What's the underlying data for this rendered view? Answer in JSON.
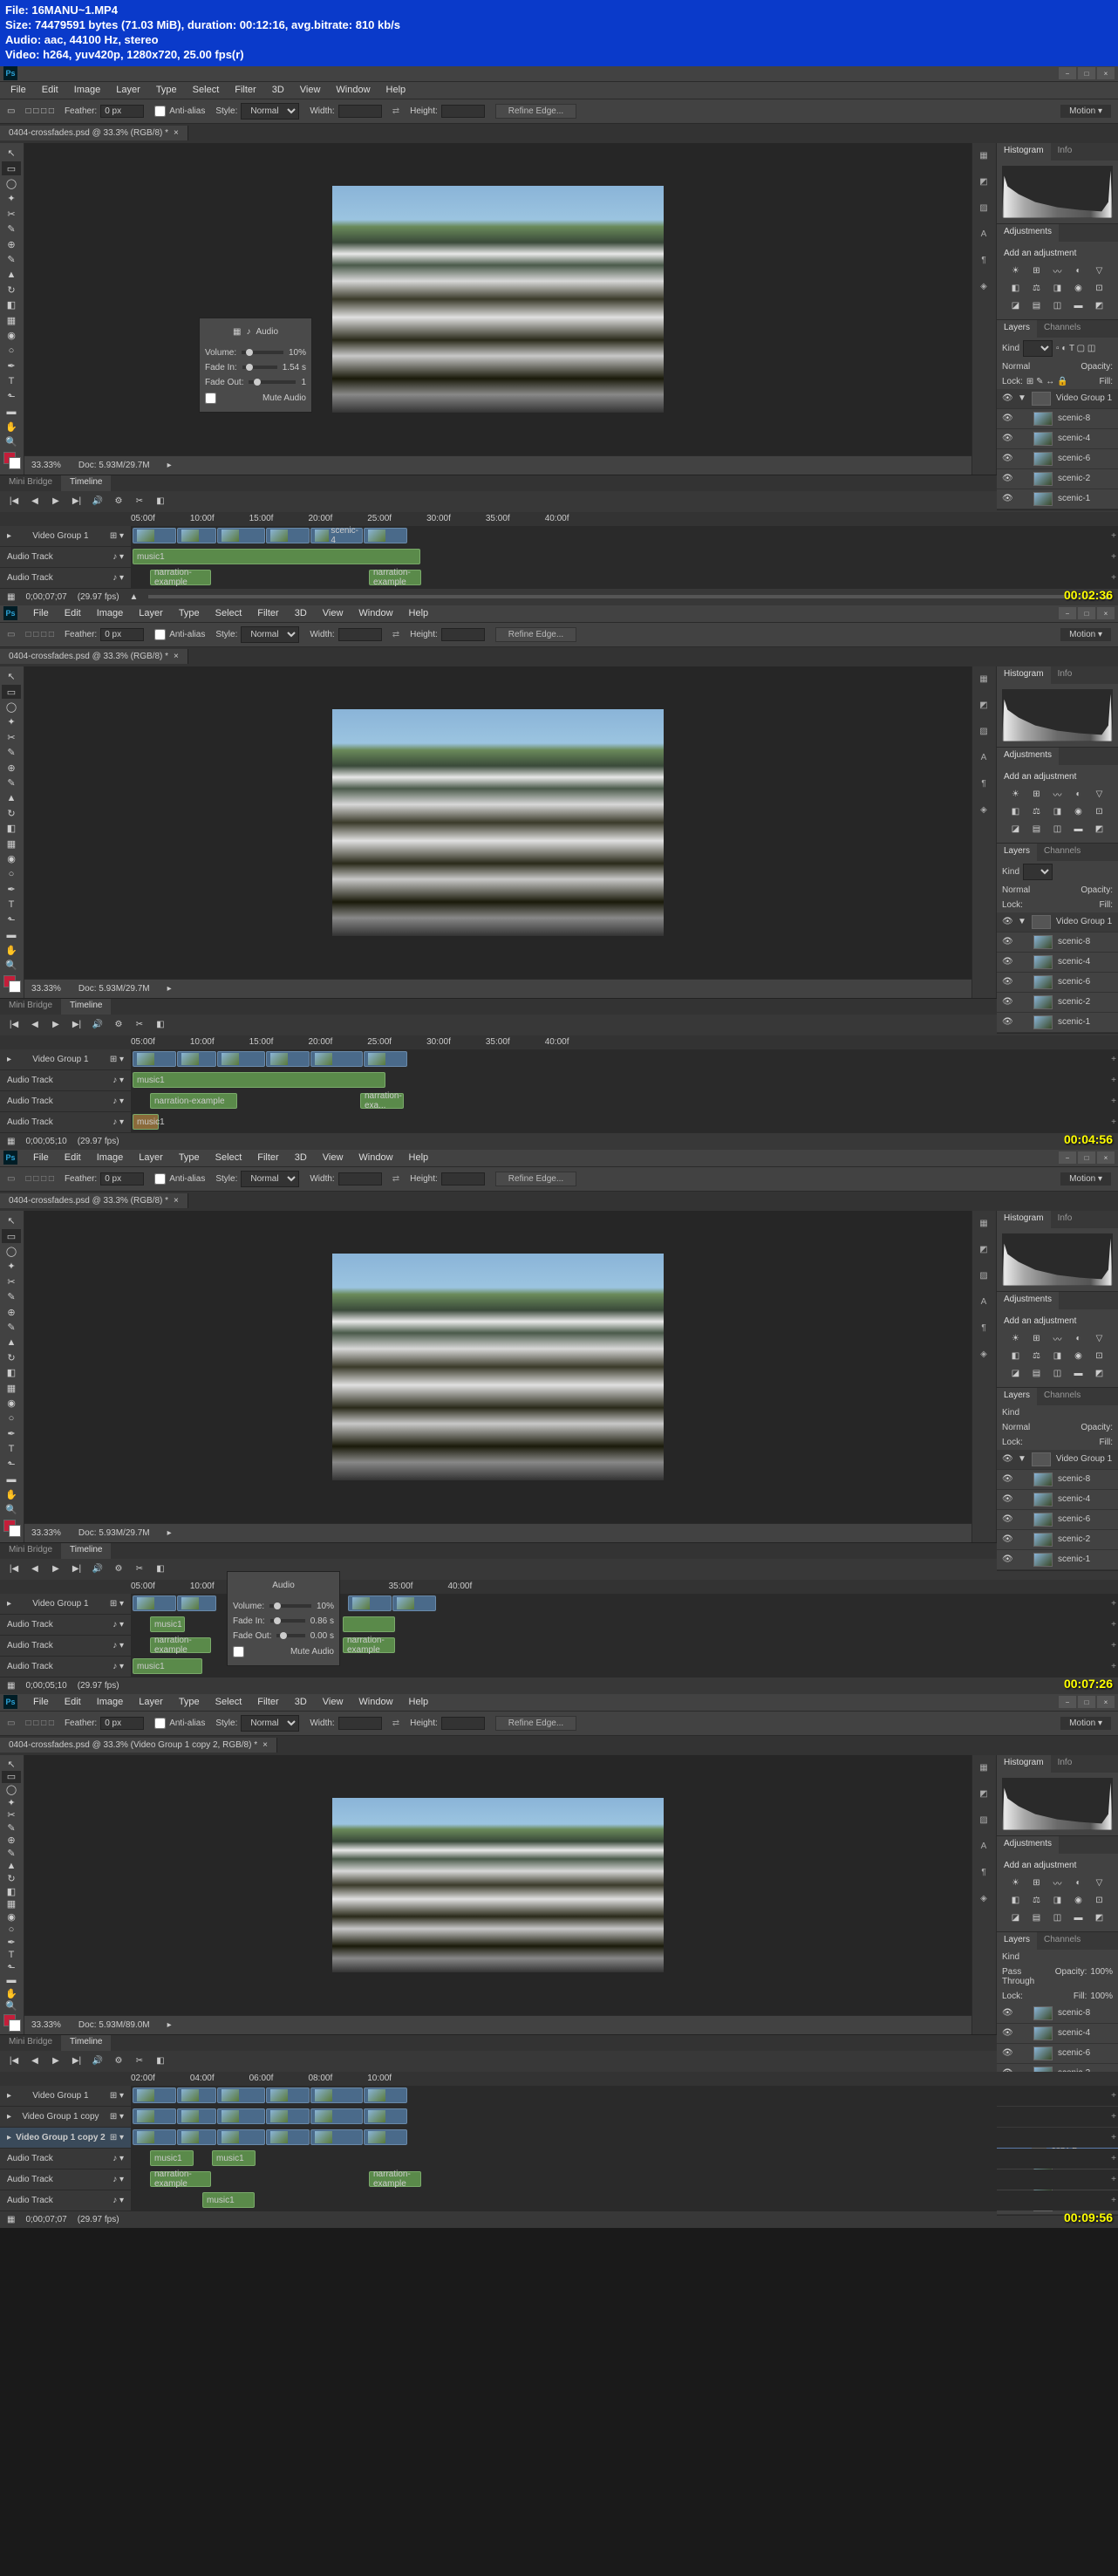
{
  "header": {
    "file": "File: 16MANU~1.MP4",
    "size": "Size: 74479591 bytes (71.03 MiB), duration: 00:12:16, avg.bitrate: 810 kb/s",
    "audio": "Audio: aac, 44100 Hz, stereo",
    "video": "Video: h264, yuv420p, 1280x720, 25.00 fps(r)"
  },
  "menu": [
    "File",
    "Edit",
    "Image",
    "Layer",
    "Type",
    "Select",
    "Filter",
    "3D",
    "View",
    "Window",
    "Help"
  ],
  "workspace": "Motion",
  "options": {
    "feather_label": "Feather:",
    "feather": "0 px",
    "antialias": "Anti-alias",
    "style_label": "Style:",
    "style": "Normal",
    "width_label": "Width:",
    "height_label": "Height:",
    "refine": "Refine Edge..."
  },
  "doc_tab": "0404-crossfades.psd @ 33.3% (RGB/8) *",
  "doc_tab_alt": "0404-crossfades.psd @ 33.3% (Video Group 1 copy 2, RGB/8) *",
  "status": {
    "zoom": "33.33%",
    "doc": "Doc: 5.93M/29.7M",
    "doc_alt": "Doc: 5.93M/89.0M"
  },
  "panels": {
    "histogram": "Histogram",
    "info": "Info",
    "adjustments": "Adjustments",
    "add_adj": "Add an adjustment",
    "layers": "Layers",
    "channels": "Channels",
    "kind": "Kind",
    "normal": "Normal",
    "opacity": "Opacity:",
    "opacity_val": "100%",
    "lock": "Lock:",
    "fill": "Fill:",
    "fill_val": "100%",
    "pass_through": "Pass Through"
  },
  "layers_list": [
    "Video Group 1",
    "scenic-8",
    "scenic-4",
    "scenic-6",
    "scenic-2",
    "scenic-1"
  ],
  "layers_extra": [
    "Video Group 1 copy",
    "Video Group 1 copy 2"
  ],
  "timeline": {
    "minibridge": "Mini Bridge",
    "timeline": "Timeline",
    "ruler": [
      "05:00f",
      "10:00f",
      "15:00f",
      "20:00f",
      "25:00f",
      "30:00f",
      "35:00f",
      "40:00f"
    ],
    "ruler2": [
      "02:00f",
      "04:00f",
      "06:00f",
      "08:00f",
      "10:00f"
    ],
    "video_group": "Video Group 1",
    "audio_track": "Audio Track",
    "music": "music1",
    "narration": "narration-example",
    "narration2": "narration-exa...",
    "scenic": "scenic-4",
    "time1": "0;00;07;07",
    "time2": "0;00;05;10",
    "fps": "(29.97 fps)"
  },
  "audio_popup": {
    "title": "Audio",
    "volume": "Volume:",
    "volume_val": "10%",
    "fadein": "Fade In:",
    "fadein_val1": "1.54 s",
    "fadein_val2": "0.86 s",
    "fadeout": "Fade Out:",
    "fadeout_val": "1",
    "fadeout_val2": "0.00 s",
    "mute": "Mute Audio"
  },
  "timestamps": [
    "00:02:36",
    "00:04:56",
    "00:07:26",
    "00:09:56"
  ]
}
